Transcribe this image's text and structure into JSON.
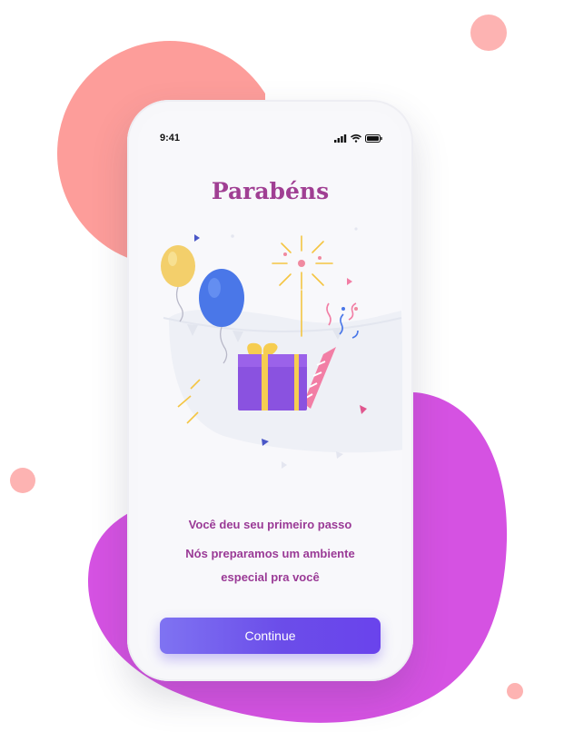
{
  "status_bar": {
    "time": "9:41"
  },
  "screen": {
    "title": "Parabéns",
    "message_line1": "Você deu seu primeiro passo",
    "message_line2": "Nós preparamos um ambiente",
    "message_line3": "especial pra você",
    "continue_label": "Continue"
  },
  "colors": {
    "coral_blob": "#fc9c99",
    "magenta_blob": "#d44fe0",
    "title": "#a03f93",
    "button": "#6b4de9"
  },
  "icons": [
    "signal-icon",
    "wifi-icon",
    "battery-icon",
    "balloon-icon",
    "gift-icon",
    "firework-icon",
    "party-popper-icon",
    "confetti-icon"
  ]
}
